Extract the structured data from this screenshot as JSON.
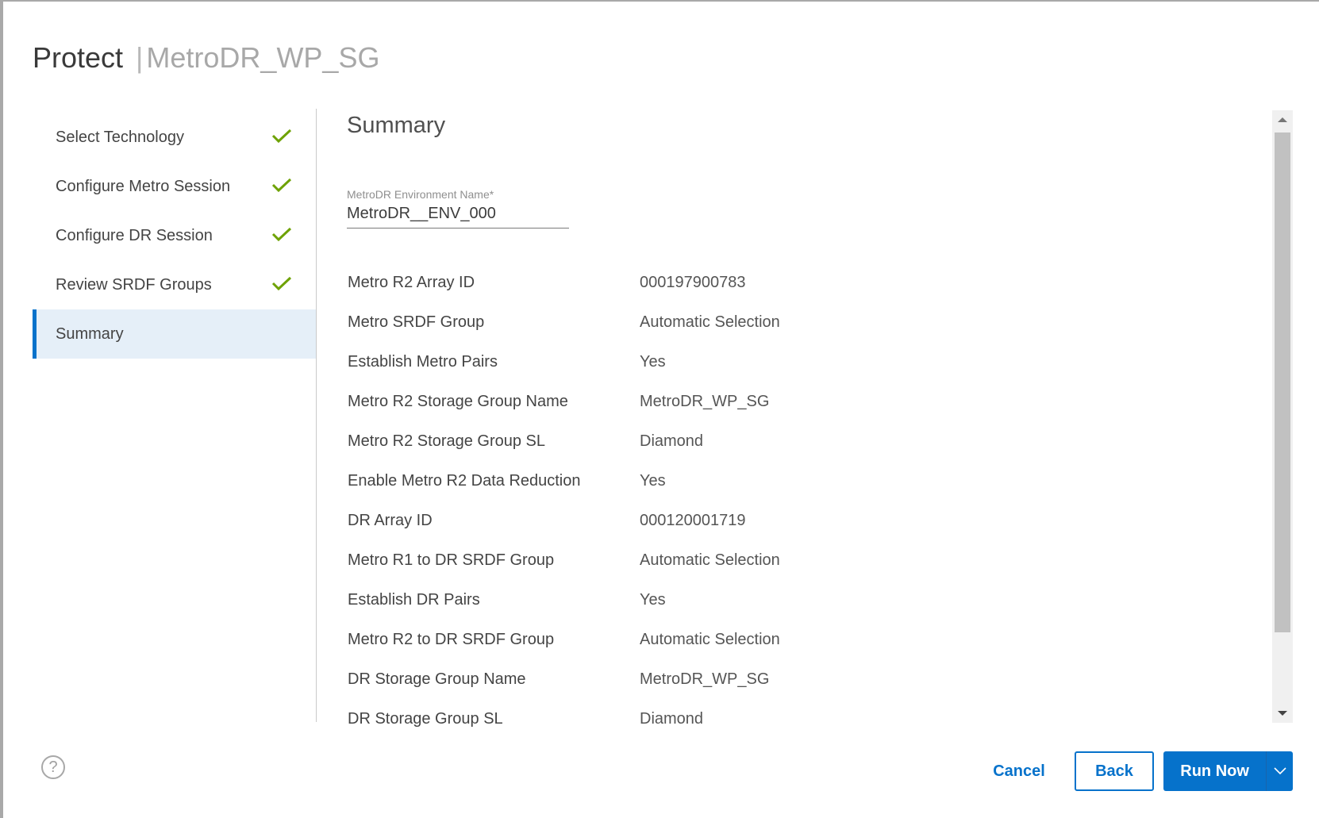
{
  "header": {
    "title": "Protect",
    "separator": "|",
    "subtitle": "MetroDR_WP_SG"
  },
  "steps": [
    {
      "label": "Select Technology",
      "status": "complete",
      "icon": "check-icon"
    },
    {
      "label": "Configure Metro Session",
      "status": "complete",
      "icon": "check-icon"
    },
    {
      "label": "Configure DR Session",
      "status": "complete",
      "icon": "check-icon"
    },
    {
      "label": "Review SRDF Groups",
      "status": "complete",
      "icon": "check-icon"
    },
    {
      "label": "Summary",
      "status": "active"
    }
  ],
  "content": {
    "title": "Summary",
    "env_field": {
      "label": "MetroDR Environment Name*",
      "value": "MetroDR__ENV_000"
    },
    "rows": [
      {
        "key": "Metro R2 Array ID",
        "value": "000197900783"
      },
      {
        "key": "Metro SRDF Group",
        "value": "Automatic Selection"
      },
      {
        "key": "Establish Metro Pairs",
        "value": "Yes"
      },
      {
        "key": "Metro R2 Storage Group Name",
        "value": "MetroDR_WP_SG"
      },
      {
        "key": "Metro R2 Storage Group SL",
        "value": "Diamond"
      },
      {
        "key": "Enable Metro R2 Data Reduction",
        "value": "Yes"
      },
      {
        "key": "DR Array ID",
        "value": "000120001719"
      },
      {
        "key": "Metro R1 to DR SRDF Group",
        "value": "Automatic Selection"
      },
      {
        "key": "Establish DR Pairs",
        "value": "Yes"
      },
      {
        "key": "Metro R2 to DR SRDF Group",
        "value": "Automatic Selection"
      },
      {
        "key": "DR Storage Group Name",
        "value": "MetroDR_WP_SG"
      },
      {
        "key": "DR Storage Group SL",
        "value": "Diamond"
      }
    ]
  },
  "footer": {
    "help_glyph": "?",
    "cancel_label": "Cancel",
    "back_label": "Back",
    "run_label": "Run Now"
  },
  "colors": {
    "accent": "#0672cb",
    "check": "#6ea204",
    "active_step_bg": "#e5eff8"
  }
}
